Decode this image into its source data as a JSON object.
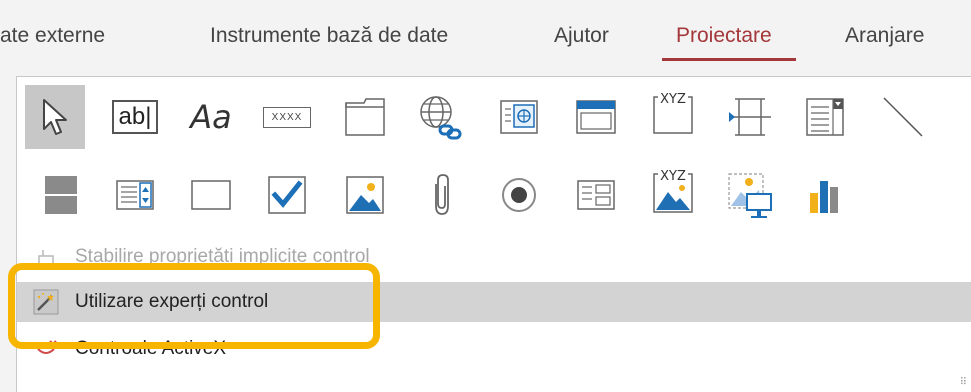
{
  "tabs": [
    {
      "label": "ate externe"
    },
    {
      "label": "Instrumente bază de date"
    },
    {
      "label": "Ajutor"
    },
    {
      "label": "Proiectare"
    },
    {
      "label": "Aranjare"
    }
  ],
  "active_tab": "Proiectare",
  "accent_color": "#a4373a",
  "controls": {
    "row1": [
      {
        "name": "select-pointer-icon"
      },
      {
        "name": "textbox-icon",
        "text": "ab|"
      },
      {
        "name": "label-icon",
        "text": "Aa"
      },
      {
        "name": "button-icon",
        "text": "XXXX"
      },
      {
        "name": "tab-control-icon"
      },
      {
        "name": "hyperlink-icon"
      },
      {
        "name": "web-browser-icon"
      },
      {
        "name": "navigation-control-icon"
      },
      {
        "name": "option-group-icon",
        "text": "XYZ"
      },
      {
        "name": "page-break-icon"
      },
      {
        "name": "combo-box-icon"
      },
      {
        "name": "line-icon"
      }
    ],
    "row2": [
      {
        "name": "toggle-button-icon"
      },
      {
        "name": "list-box-icon"
      },
      {
        "name": "rectangle-icon"
      },
      {
        "name": "checkbox-icon"
      },
      {
        "name": "image-icon"
      },
      {
        "name": "attachment-icon"
      },
      {
        "name": "option-button-icon"
      },
      {
        "name": "subform-icon"
      },
      {
        "name": "bound-object-frame-icon",
        "text": "XYZ"
      },
      {
        "name": "unbound-object-frame-icon"
      },
      {
        "name": "chart-icon"
      }
    ]
  },
  "menu": {
    "set_defaults": "Stabilire proprietăți implicite control",
    "use_wizards": "Utilizare experți control",
    "activex": "Controale ActiveX"
  },
  "highlight_color": "#f7b500"
}
